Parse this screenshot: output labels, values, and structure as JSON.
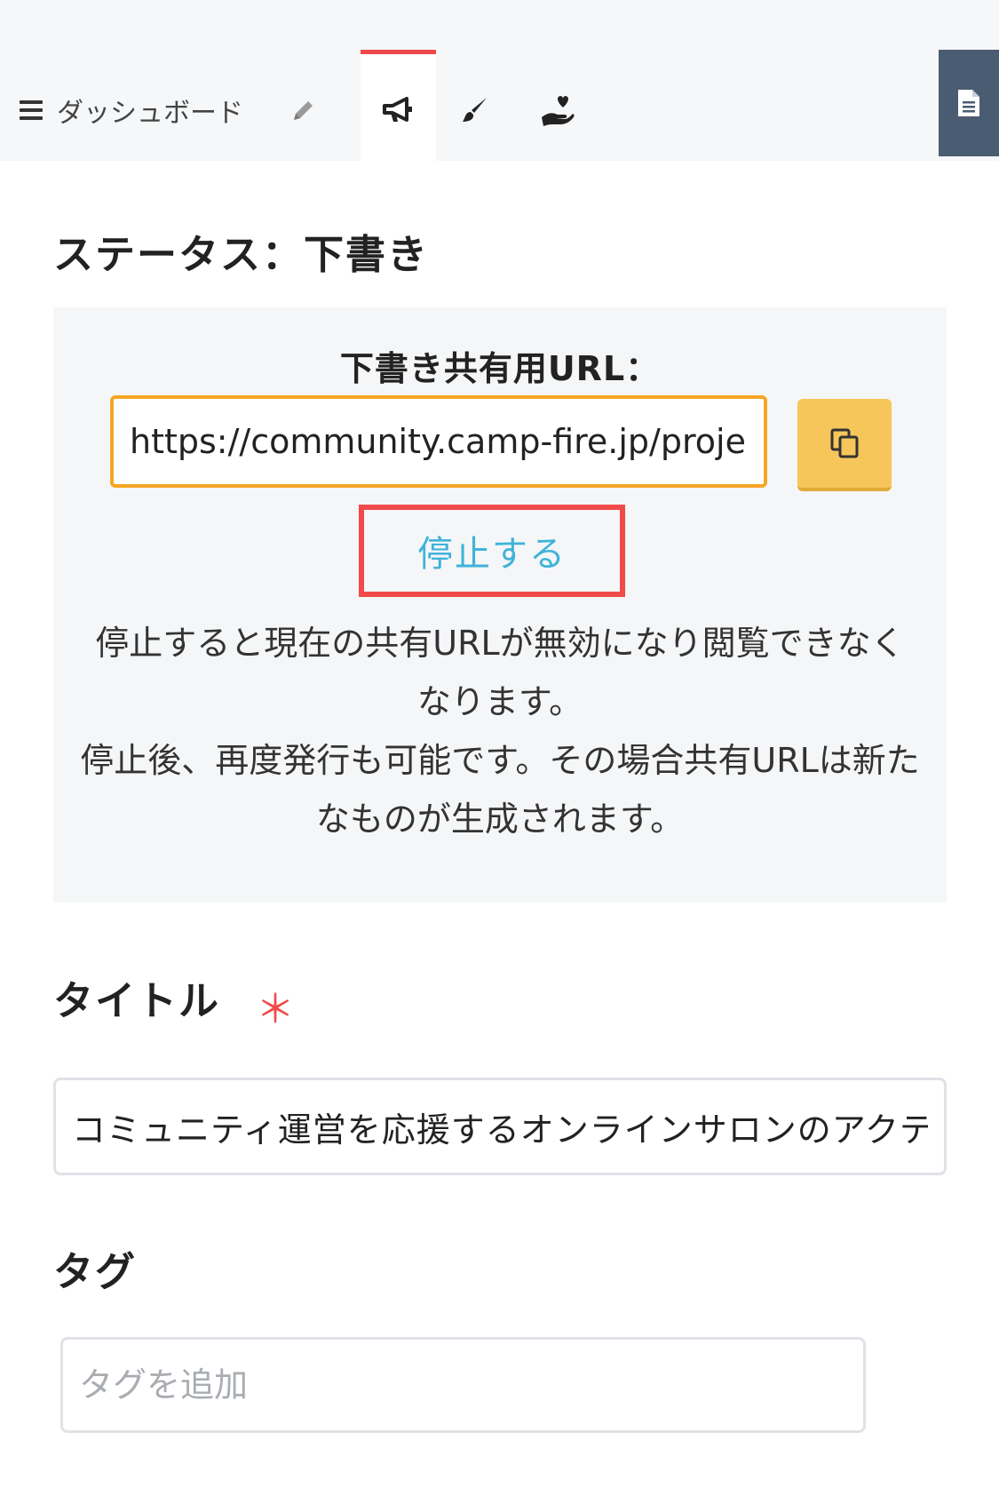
{
  "nav": {
    "dashboard_label": "ダッシュボード",
    "tabs": [
      {
        "icon": "pencil-icon",
        "active": false
      },
      {
        "icon": "megaphone-icon",
        "active": true
      },
      {
        "icon": "brush-icon",
        "active": false
      },
      {
        "icon": "hand-heart-icon",
        "active": false
      }
    ],
    "right_button_icon": "document-icon",
    "active_color": "#ef4a4a"
  },
  "status": {
    "text": "ステータス：下書き"
  },
  "share": {
    "label": "下書き共有用URL：",
    "url": "https://community.camp-fire.jp/projects/",
    "copy_icon": "copy-icon",
    "stop_label": "停止する",
    "note_line1": "停止すると現在の共有URLが無効になり閲覧できなくなります。",
    "note_line2": "停止後、再度発行も可能です。その場合共有URLは新たなものが生成されます。"
  },
  "title_field": {
    "label": "タイトル",
    "required": "＊",
    "value": "コミュニティ運営を応援するオンラインサロンのアクテ"
  },
  "tag_field": {
    "label": "タグ",
    "placeholder": "タグを追加"
  }
}
